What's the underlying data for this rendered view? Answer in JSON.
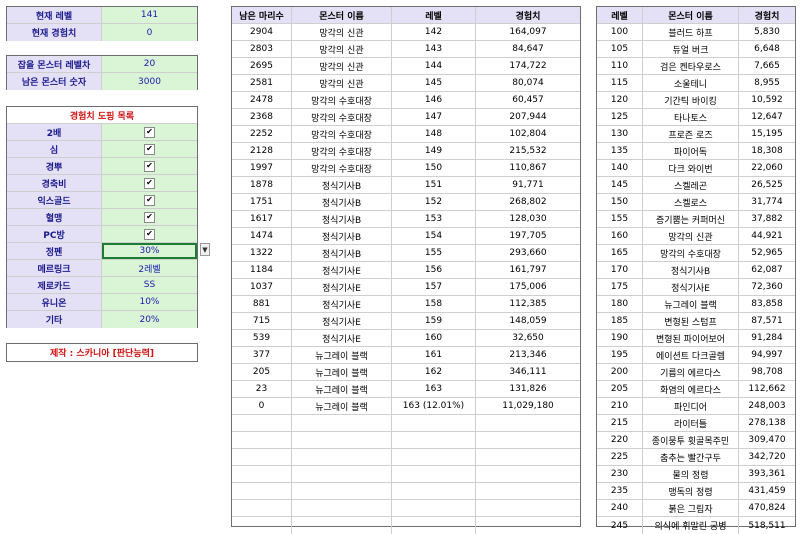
{
  "info": [
    {
      "label": "현재 레벨",
      "value": "141"
    },
    {
      "label": "현재 경험치",
      "value": "0"
    }
  ],
  "hunt": [
    {
      "label": "잡을 몬스터 레벨차",
      "value": "20"
    },
    {
      "label": "남은 몬스터 숫자",
      "value": "3000"
    }
  ],
  "doping": {
    "title": "경험치 도핑 목록",
    "items": [
      {
        "label": "2배",
        "type": "check",
        "value": "✔"
      },
      {
        "label": "심",
        "type": "check",
        "value": "✔"
      },
      {
        "label": "경뿌",
        "type": "check",
        "value": "✔"
      },
      {
        "label": "경축비",
        "type": "check",
        "value": "✔"
      },
      {
        "label": "익스골드",
        "type": "check",
        "value": "✔"
      },
      {
        "label": "혈맹",
        "type": "check",
        "value": "✔"
      },
      {
        "label": "PC방",
        "type": "check",
        "value": "✔"
      },
      {
        "label": "정펜",
        "type": "select",
        "value": "30%"
      },
      {
        "label": "메르링크",
        "type": "text",
        "value": "2레벨"
      },
      {
        "label": "제로카드",
        "type": "text",
        "value": "SS"
      },
      {
        "label": "유니온",
        "type": "text",
        "value": "10%"
      },
      {
        "label": "기타",
        "type": "text",
        "value": "20%"
      }
    ]
  },
  "credit": "제작 : 스카니아 [판단능력]",
  "main_table": {
    "headers": [
      "남은 마리수",
      "몬스터 이름",
      "레벨",
      "경험치"
    ],
    "rows": [
      [
        "2904",
        "망각의 신관",
        "142",
        "164,097"
      ],
      [
        "2803",
        "망각의 신관",
        "143",
        "84,647"
      ],
      [
        "2695",
        "망각의 신관",
        "144",
        "174,722"
      ],
      [
        "2581",
        "망각의 신관",
        "145",
        "80,074"
      ],
      [
        "2478",
        "망각의 수호대장",
        "146",
        "60,457"
      ],
      [
        "2368",
        "망각의 수호대장",
        "147",
        "207,944"
      ],
      [
        "2252",
        "망각의 수호대장",
        "148",
        "102,804"
      ],
      [
        "2128",
        "망각의 수호대장",
        "149",
        "215,532"
      ],
      [
        "1997",
        "망각의 수호대장",
        "150",
        "110,867"
      ],
      [
        "1878",
        "정식기사B",
        "151",
        "91,771"
      ],
      [
        "1751",
        "정식기사B",
        "152",
        "268,802"
      ],
      [
        "1617",
        "정식기사B",
        "153",
        "128,030"
      ],
      [
        "1474",
        "정식기사B",
        "154",
        "197,705"
      ],
      [
        "1322",
        "정식기사B",
        "155",
        "293,660"
      ],
      [
        "1184",
        "정식기사E",
        "156",
        "161,797"
      ],
      [
        "1037",
        "정식기사E",
        "157",
        "175,006"
      ],
      [
        "881",
        "정식기사E",
        "158",
        "112,385"
      ],
      [
        "715",
        "정식기사E",
        "159",
        "148,059"
      ],
      [
        "539",
        "정식기사E",
        "160",
        "32,650"
      ],
      [
        "377",
        "뉴그레이 블랙",
        "161",
        "213,346"
      ],
      [
        "205",
        "뉴그레이 블랙",
        "162",
        "346,111"
      ],
      [
        "23",
        "뉴그레이 블랙",
        "163",
        "131,826"
      ],
      [
        "0",
        "뉴그레이 블랙",
        "163 (12.01%)",
        "11,029,180"
      ],
      [
        "",
        "",
        "",
        ""
      ],
      [
        "",
        "",
        "",
        ""
      ],
      [
        "",
        "",
        "",
        ""
      ],
      [
        "",
        "",
        "",
        ""
      ],
      [
        "",
        "",
        "",
        ""
      ],
      [
        "",
        "",
        "",
        ""
      ],
      [
        "",
        "",
        "",
        ""
      ]
    ]
  },
  "ref_table": {
    "headers": [
      "레벨",
      "몬스터 이름",
      "경험치"
    ],
    "rows": [
      [
        "100",
        "블러드 하프",
        "5,830"
      ],
      [
        "105",
        "듀얼 버크",
        "6,648"
      ],
      [
        "110",
        "검은 켄타우로스",
        "7,665"
      ],
      [
        "115",
        "소울테니",
        "8,955"
      ],
      [
        "120",
        "기간틱 바이킹",
        "10,592"
      ],
      [
        "125",
        "타나토스",
        "12,647"
      ],
      [
        "130",
        "프로즌 로즈",
        "15,195"
      ],
      [
        "135",
        "파이어독",
        "18,308"
      ],
      [
        "140",
        "다크 와이번",
        "22,060"
      ],
      [
        "145",
        "스켈레곤",
        "26,525"
      ],
      [
        "150",
        "스켈로스",
        "31,774"
      ],
      [
        "155",
        "증기뿜는 커퍼머신",
        "37,882"
      ],
      [
        "160",
        "망각의 신관",
        "44,921"
      ],
      [
        "165",
        "망각의 수호대장",
        "52,965"
      ],
      [
        "170",
        "정식기사B",
        "62,087"
      ],
      [
        "175",
        "정식기사E",
        "72,360"
      ],
      [
        "180",
        "뉴그레이 블랙",
        "83,858"
      ],
      [
        "185",
        "변형된 스텀프",
        "87,571"
      ],
      [
        "190",
        "변형된 파이어보어",
        "91,284"
      ],
      [
        "195",
        "에이션트 다크골렘",
        "94,997"
      ],
      [
        "200",
        "기름의 에르다스",
        "98,708"
      ],
      [
        "205",
        "화염의 에르다스",
        "112,662"
      ],
      [
        "210",
        "파인디어",
        "248,003"
      ],
      [
        "215",
        "라이터틀",
        "278,138"
      ],
      [
        "220",
        "종이뭉투 휫골목주민",
        "309,470"
      ],
      [
        "225",
        "춤추는 빨간구두",
        "342,720"
      ],
      [
        "230",
        "물의 정령",
        "393,361"
      ],
      [
        "235",
        "맹독의 정령",
        "431,459"
      ],
      [
        "240",
        "붉은 그림자",
        "470,824"
      ],
      [
        "245",
        "의식에 휘말린 궁병",
        "518,511"
      ]
    ]
  }
}
